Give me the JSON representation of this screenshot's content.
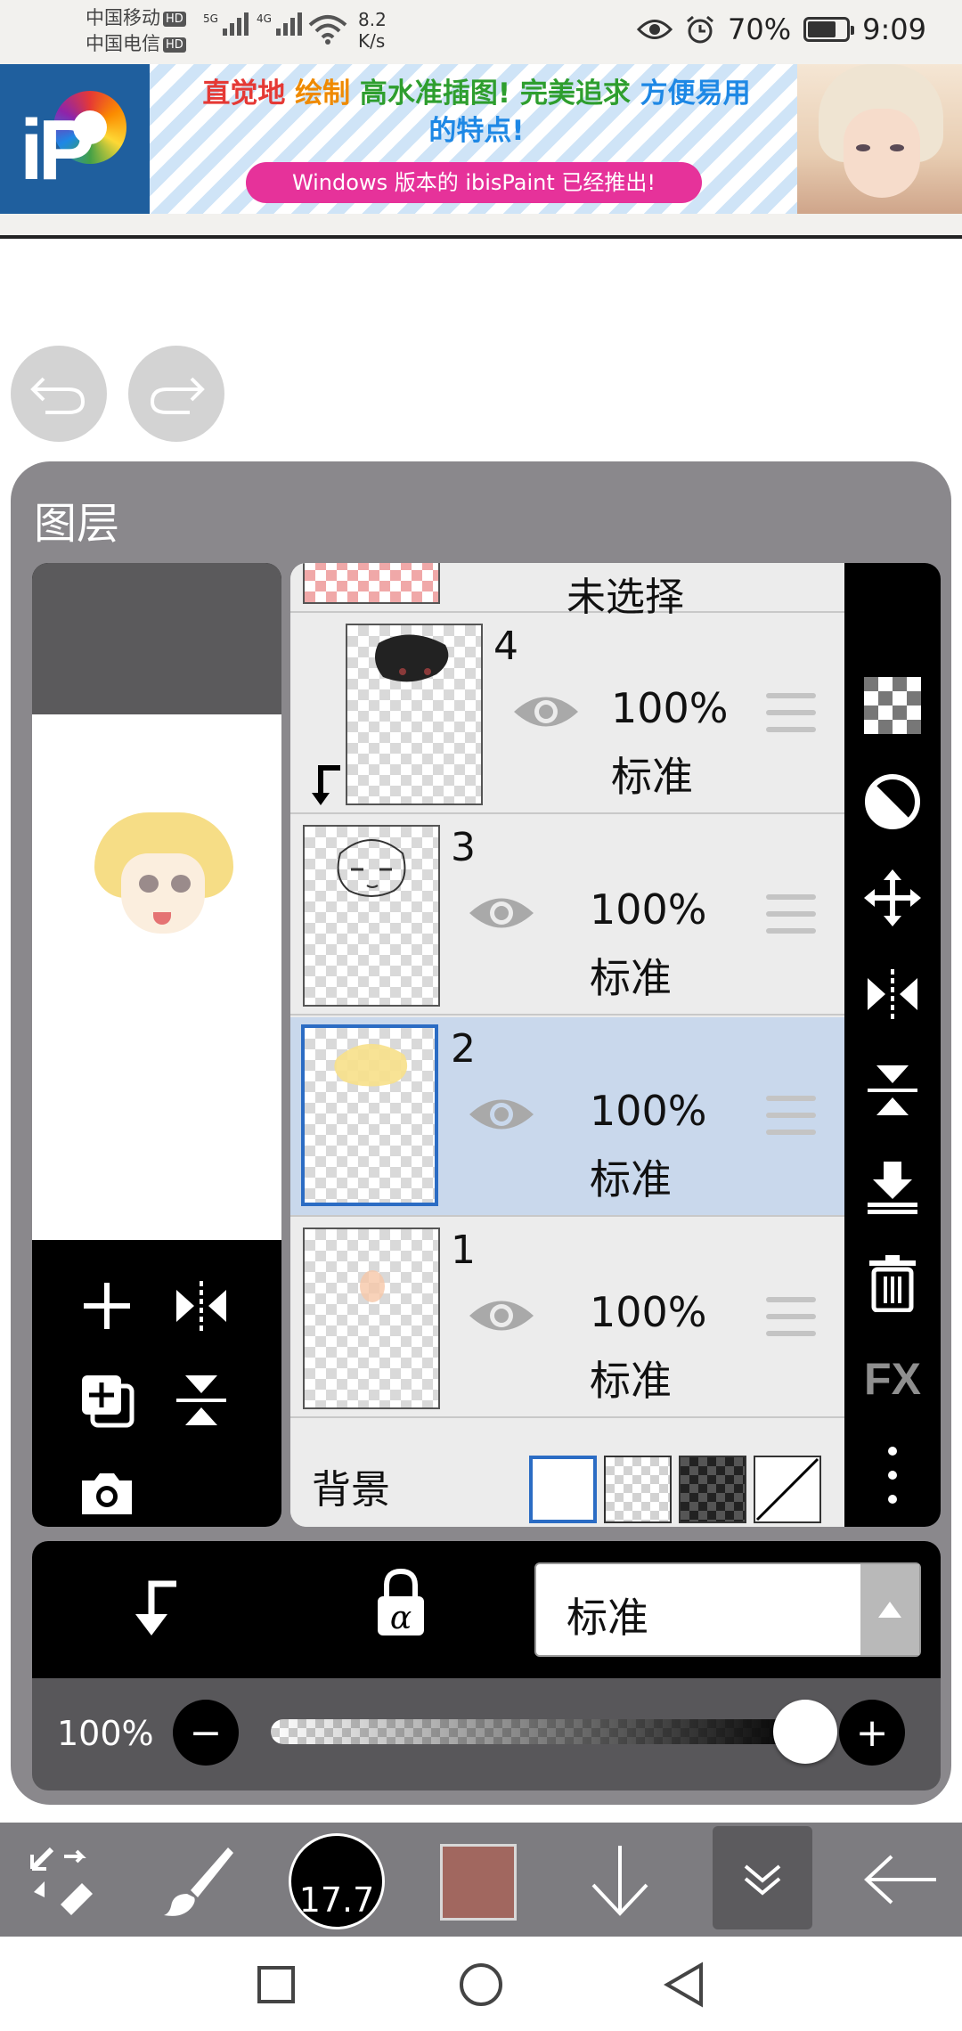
{
  "status_bar": {
    "carrier_1": "中国移动",
    "carrier_2": "中国电信",
    "hd_badge": "HD",
    "signal_1_label": "5G",
    "signal_2_label": "4G",
    "net_speed_value": "8.2",
    "net_speed_unit": "K/s",
    "battery_percent": "70%",
    "battery_level": 0.7,
    "time": "9:09",
    "icons": [
      "eye-icon",
      "alarm-icon",
      "battery-icon",
      "wifi-icon"
    ]
  },
  "ad_banner": {
    "headline_part_1": "直觉地",
    "headline_part_2": "绘制",
    "headline_part_3": "高水准插图!",
    "headline_part_4": "完美追求",
    "headline_part_5": "方便易用",
    "headline_part_6": "的特点!",
    "cta_text": "Windows 版本的 ibisPaint 已经推出!",
    "logo_text": "iP",
    "colors": {
      "red": "#e53935",
      "orange": "#ef8a00",
      "green": "#2e9e2e",
      "blue": "#1e88e5",
      "cta_pink": "#e6329a",
      "logo_blue": "#1f5f9e"
    }
  },
  "history": {
    "undo_icon": "undo-icon",
    "redo_icon": "redo-icon"
  },
  "layer_panel": {
    "title": "图层",
    "unselected_label": "未选择",
    "layers": [
      {
        "number": "4",
        "opacity": "100%",
        "mode": "标准",
        "visible": true,
        "clipped": true,
        "selected": false
      },
      {
        "number": "3",
        "opacity": "100%",
        "mode": "标准",
        "visible": true,
        "clipped": false,
        "selected": false
      },
      {
        "number": "2",
        "opacity": "100%",
        "mode": "标准",
        "visible": true,
        "clipped": false,
        "selected": true
      },
      {
        "number": "1",
        "opacity": "100%",
        "mode": "标准",
        "visible": true,
        "clipped": false,
        "selected": false
      }
    ],
    "background_label": "背景",
    "background_options": [
      "white",
      "transparent-light",
      "transparent-dark",
      "none"
    ],
    "selected_background": "white",
    "preview_tools": [
      "add-layer-icon",
      "flip-horizontal-icon",
      "duplicate-layer-icon",
      "flip-vertical-icon",
      "camera-icon"
    ],
    "side_tools": [
      "transparency-icon",
      "invert-icon",
      "move-icon",
      "flip-horizontal-icon",
      "flip-vertical-icon",
      "merge-down-icon",
      "delete-icon",
      "fx-icon",
      "more-icon"
    ],
    "fx_label": "FX",
    "selection_color": "#c9d8ec",
    "selection_border": "#2b6cc4"
  },
  "blend_bar": {
    "clip_icon": "clip-icon",
    "alpha_lock_icon": "alpha-lock-icon",
    "blend_mode": "标准",
    "dropdown_icon": "triangle-up-icon"
  },
  "opacity_bar": {
    "label": "100%",
    "value": 1.0,
    "minus": "−",
    "plus": "+"
  },
  "bottom_toolbar": {
    "tools": [
      "transform-tool-icon",
      "brush-icon",
      "brush-size",
      "color",
      "down-arrow-icon",
      "collapse-icon",
      "back-icon"
    ],
    "brush_size": "17.7",
    "current_color": "#a1675f"
  },
  "nav_bar": {
    "buttons": [
      "recent-apps-icon",
      "home-icon",
      "back-nav-icon"
    ]
  }
}
